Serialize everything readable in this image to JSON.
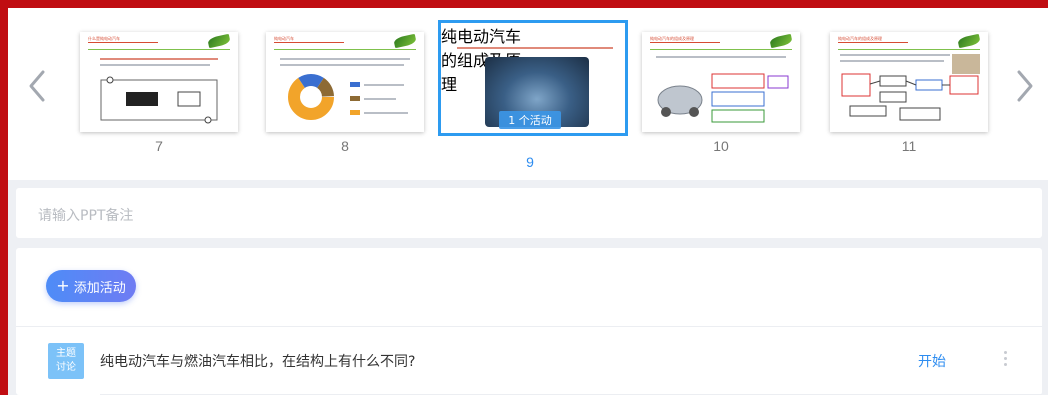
{
  "slides": [
    {
      "number": "7",
      "title": "什么是纯电动汽车"
    },
    {
      "number": "8",
      "title": "纯电动汽车"
    },
    {
      "number": "9",
      "title": "纯电动汽车的组成及原理",
      "activity_label": "1 个活动"
    },
    {
      "number": "10",
      "title": "纯电动汽车的组成及原理"
    },
    {
      "number": "11",
      "title": "纯电动汽车的组成及原理"
    }
  ],
  "notes": {
    "placeholder": "请输入PPT备注"
  },
  "activities": {
    "add_label": "添加活动",
    "items": [
      {
        "badge_line1": "主题",
        "badge_line2": "讨论",
        "text": "纯电动汽车与燃油汽车相比，在结构上有什么不同?",
        "action": "开始"
      }
    ]
  },
  "colors": {
    "frame": "#c00d12",
    "accent": "#2d8cf0",
    "active_border": "#2d9bf0",
    "badge": "#7cc2f8"
  },
  "icons": {
    "prev": "chevron-left-icon",
    "next": "chevron-right-icon",
    "expand": "expand-icon",
    "more": "more-vertical-icon"
  }
}
